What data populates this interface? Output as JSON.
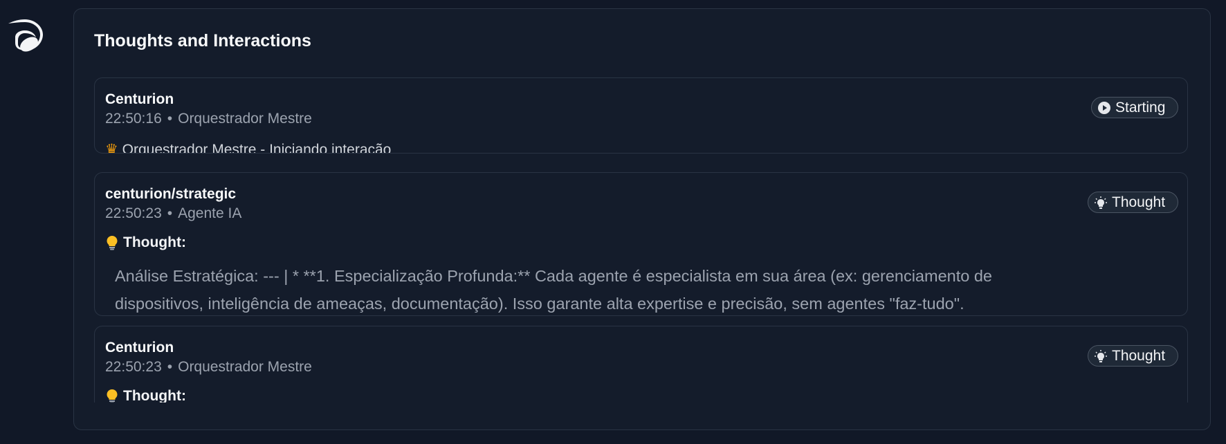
{
  "app": {
    "logo_icon": "feather-leaf-icon"
  },
  "panel": {
    "title": "Thoughts and Interactions"
  },
  "cards": [
    {
      "agent": "Centurion",
      "time": "22:50:16",
      "role": "Orquestrador Mestre",
      "badge": {
        "label": "Starting",
        "icon": "play-circle-icon"
      },
      "message_icon": "crown-icon",
      "message": "Orquestrador Mestre - Iniciando interação"
    },
    {
      "agent": "centurion/strategic",
      "time": "22:50:23",
      "role": "Agente IA",
      "badge": {
        "label": "Thought",
        "icon": "lightbulb-icon"
      },
      "thought_icon": "lightbulb-icon",
      "thought_label": "Thought:",
      "thought_line_1": "Análise Estratégica: --- | *   **1. Especialização Profunda:** Cada agente é especialista em sua área (ex: gerenciamento de",
      "thought_line_2": "dispositivos, inteligência de ameaças, documentação). Isso garante alta expertise e precisão, sem agentes \"faz-tudo\"."
    },
    {
      "agent": "Centurion",
      "time": "22:50:23",
      "role": "Orquestrador Mestre",
      "badge": {
        "label": "Thought",
        "icon": "lightbulb-icon"
      },
      "thought_icon": "lightbulb-icon",
      "thought_label": "Thought:"
    }
  ],
  "separator": "•",
  "colors": {
    "background": "#111827",
    "panel": "#141c2b",
    "border": "#2a3444",
    "text_primary": "#f9fafb",
    "text_muted": "#9ca3af",
    "bulb": "#fbbf24"
  }
}
